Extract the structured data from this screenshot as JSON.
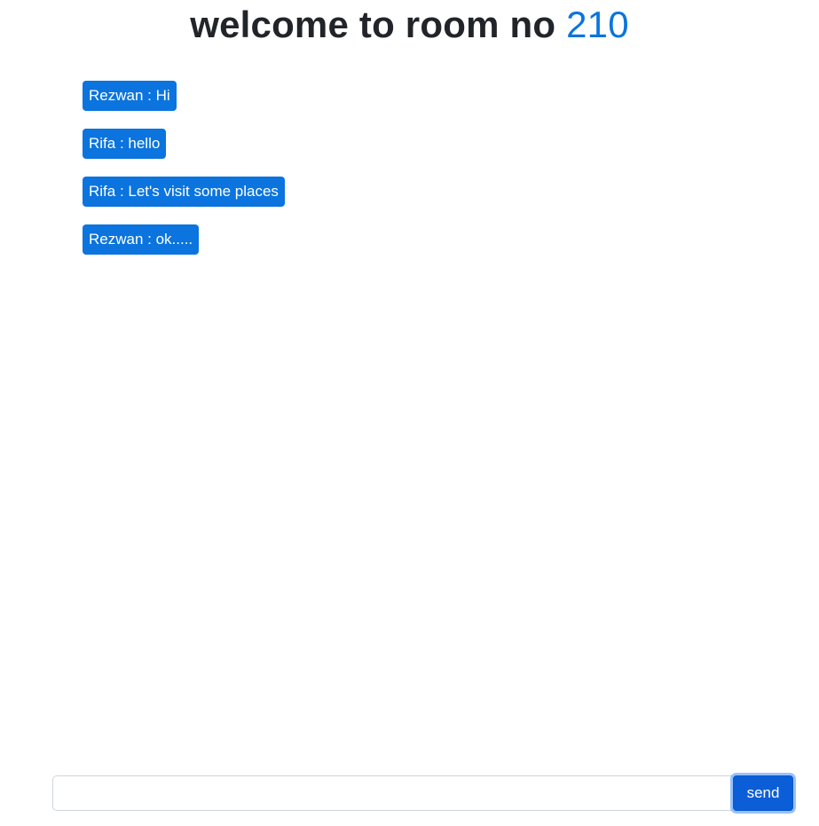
{
  "header": {
    "title_prefix": "welcome to room no",
    "room_number": "210"
  },
  "messages": [
    {
      "sender": "Rezwan",
      "text": "Hi",
      "display": "Rezwan : Hi"
    },
    {
      "sender": "Rifa",
      "text": "hello",
      "display": "Rifa : hello"
    },
    {
      "sender": "Rifa",
      "text": "Let's visit some places",
      "display": "Rifa : Let's visit some places"
    },
    {
      "sender": "Rezwan",
      "text": "ok.....",
      "display": "Rezwan : ok....."
    }
  ],
  "composer": {
    "input_value": "",
    "send_label": "send"
  },
  "colors": {
    "accent": "#0b74de",
    "button": "#0b5ed7",
    "text": "#212529"
  }
}
